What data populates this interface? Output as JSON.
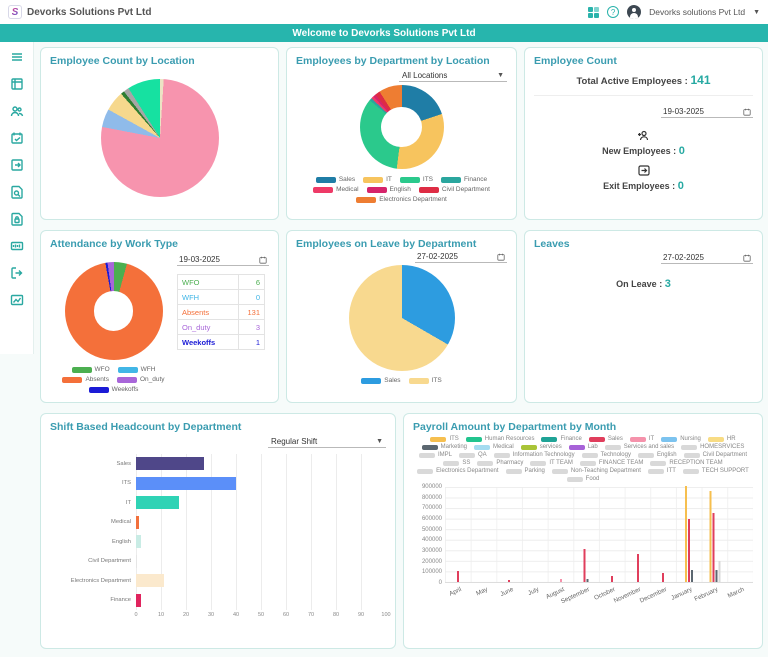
{
  "header": {
    "logo_letter": "S",
    "company_name": "Devorks Solutions Pvt Ltd",
    "account_name": "Devorks solutions Pvt Ltd",
    "banner": "Welcome to Devorks Solutions Pvt Ltd"
  },
  "sidebar": {
    "icons": [
      "menu",
      "payslip",
      "team",
      "calendar-check",
      "checkout",
      "report-search",
      "document-lock",
      "crm",
      "logout",
      "analytics"
    ]
  },
  "cards": {
    "location_count": {
      "title": "Employee Count by Location"
    },
    "dept_by_location": {
      "title": "Employees by Department by Location",
      "filter": "All Locations"
    },
    "employee_count": {
      "title": "Employee Count",
      "total_label": "Total Active Employees :",
      "total_value": "141",
      "date": "19-03-2025",
      "new_label": "New Employees :",
      "new_value": "0",
      "exit_label": "Exit Employees :",
      "exit_value": "0"
    },
    "attendance": {
      "title": "Attendance by Work Type",
      "date": "19-03-2025"
    },
    "leave_dept": {
      "title": "Employees on Leave by Department",
      "date": "27-02-2025"
    },
    "leaves": {
      "title": "Leaves",
      "date": "27-02-2025",
      "label": "On Leave :",
      "value": "3"
    },
    "shift": {
      "title": "Shift Based Headcount by Department",
      "filter": "Regular Shift"
    },
    "payroll": {
      "title": "Payroll Amount by Department by Month"
    }
  },
  "chart_data": [
    {
      "id": "location_pie",
      "type": "pie",
      "title": "Employee Count by Location",
      "segments": [
        {
          "color": "#ece3c4",
          "percent": 1
        },
        {
          "color": "#f794ae",
          "percent": 77
        },
        {
          "color": "#8fbbea",
          "percent": 5
        },
        {
          "color": "#f6d88d",
          "percent": 5.5
        },
        {
          "color": "#2e7d32",
          "percent": 1
        },
        {
          "color": "#a6a6a6",
          "percent": 1.5
        },
        {
          "color": "#16e1a1",
          "percent": 9
        }
      ]
    },
    {
      "id": "dept_donut",
      "type": "pie",
      "donut": true,
      "title": "Employees by Department by Location",
      "slices": [
        {
          "label": "Sales",
          "color": "#1f7da6",
          "percent": 20
        },
        {
          "label": "IT",
          "color": "#f7c45e",
          "percent": 32
        },
        {
          "label": "ITS",
          "color": "#2bc98c",
          "percent": 34
        },
        {
          "label": "Finance",
          "color": "#2aa69e",
          "percent": 1
        },
        {
          "label": "Medical",
          "color": "#ee3a67",
          "percent": 1
        },
        {
          "label": "English",
          "color": "#d6246b",
          "percent": 1
        },
        {
          "label": "Civil Department",
          "color": "#de2c44",
          "percent": 2
        },
        {
          "label": "Electronics Department",
          "color": "#ee7d32",
          "percent": 9
        }
      ]
    },
    {
      "id": "attendance_donut",
      "type": "pie",
      "donut": true,
      "title": "Attendance by Work Type",
      "date": "19-03-2025",
      "rows": [
        {
          "label": "WFO",
          "value": 6,
          "color": "#4caf50"
        },
        {
          "label": "WFH",
          "value": 0,
          "color": "#41b6e6"
        },
        {
          "label": "Absents",
          "value": 131,
          "color": "#f4703a"
        },
        {
          "label": "On_duty",
          "value": 3,
          "color": "#a866d9"
        },
        {
          "label": "Weekoffs",
          "value": 1,
          "color": "#1b1bd6"
        }
      ],
      "draw_order": [
        "WFO",
        "Absents",
        "Weekoffs",
        "On_duty",
        "WFH"
      ]
    },
    {
      "id": "leave_pie",
      "type": "pie",
      "title": "Employees on Leave by Department",
      "date": "27-02-2025",
      "slices": [
        {
          "label": "Sales",
          "color": "#2d9ce0",
          "value": 1
        },
        {
          "label": "ITS",
          "color": "#f8d98f",
          "value": 2
        }
      ]
    },
    {
      "id": "shift_bar",
      "type": "bar",
      "orientation": "horizontal",
      "title": "Shift Based Headcount by Department",
      "filter": "Regular Shift",
      "categories": [
        "Sales",
        "ITS",
        "IT",
        "Medical",
        "English",
        "Civil Department",
        "Electronics Department",
        "Finance"
      ],
      "values": [
        27,
        40,
        17,
        1,
        2,
        0.5,
        11,
        2
      ],
      "bar_colors": [
        "#4f4789",
        "#5b8ff9",
        "#2fd3b5",
        "#f2703c",
        "#c9ece5",
        "#e6e6e6",
        "#fbe9cd",
        "#e0245e"
      ],
      "xlim": [
        0,
        100
      ],
      "x_ticks": [
        0,
        10,
        20,
        30,
        40,
        50,
        60,
        70,
        80,
        90,
        100
      ]
    },
    {
      "id": "payroll_bar",
      "type": "bar",
      "orientation": "vertical",
      "title": "Payroll Amount by Department by Month",
      "ylim": [
        0,
        900000
      ],
      "y_ticks": [
        0,
        100000,
        200000,
        300000,
        400000,
        500000,
        600000,
        700000,
        800000,
        900000
      ],
      "legend": [
        {
          "label": "ITS",
          "color": "#f6bf4f"
        },
        {
          "label": "Human Resources",
          "color": "#22c48e"
        },
        {
          "label": "Finance",
          "color": "#1fa396"
        },
        {
          "label": "Sales",
          "color": "#e03e5c"
        },
        {
          "label": "IT",
          "color": "#f592ab"
        },
        {
          "label": "Nursing",
          "color": "#7cc3ef"
        },
        {
          "label": "HR",
          "color": "#f8dc84"
        },
        {
          "label": "Marketing",
          "color": "#5b6770"
        },
        {
          "label": "Medical",
          "color": "#a5dcf0"
        },
        {
          "label": "services",
          "color": "#a9c437"
        },
        {
          "label": "Lab",
          "color": "#a762d8"
        },
        {
          "label": "Services and sales",
          "color": "#d9d9d9"
        },
        {
          "label": "HOMESRVICES",
          "color": "#d9d9d9"
        },
        {
          "label": "IMPL",
          "color": "#d9d9d9"
        },
        {
          "label": "QA",
          "color": "#d9d9d9"
        },
        {
          "label": "Information Technology",
          "color": "#d9d9d9"
        },
        {
          "label": "Technology",
          "color": "#d9d9d9"
        },
        {
          "label": "English",
          "color": "#d9d9d9"
        },
        {
          "label": "Civil Department",
          "color": "#d9d9d9"
        },
        {
          "label": "SS",
          "color": "#d9d9d9"
        },
        {
          "label": "Pharmacy",
          "color": "#d9d9d9"
        },
        {
          "label": "IT TEAM",
          "color": "#d9d9d9"
        },
        {
          "label": "FINANCE TEAM",
          "color": "#d9d9d9"
        },
        {
          "label": "RECEPTION TEAM",
          "color": "#d9d9d9"
        },
        {
          "label": "Electronics Department",
          "color": "#d9d9d9"
        },
        {
          "label": "Parking",
          "color": "#d9d9d9"
        },
        {
          "label": "Non-Teaching Department",
          "color": "#d9d9d9"
        },
        {
          "label": "ITT",
          "color": "#d9d9d9"
        },
        {
          "label": "TECH SUPPORT",
          "color": "#d9d9d9"
        },
        {
          "label": "Food",
          "color": "#d9d9d9"
        }
      ],
      "months": [
        "April",
        "May",
        "June",
        "July",
        "August",
        "September",
        "October",
        "November",
        "December",
        "January",
        "February",
        "March"
      ],
      "bars": [
        {
          "month": "April",
          "series": [
            {
              "label": "Sales",
              "value": 100000
            }
          ]
        },
        {
          "month": "May",
          "series": []
        },
        {
          "month": "June",
          "series": [
            {
              "label": "Sales",
              "value": 20000
            }
          ]
        },
        {
          "month": "July",
          "series": []
        },
        {
          "month": "August",
          "series": [
            {
              "label": "IT",
              "value": 30000
            }
          ]
        },
        {
          "month": "September",
          "series": [
            {
              "label": "Sales",
              "value": 310000
            },
            {
              "label": "Marketing",
              "value": 30000
            }
          ]
        },
        {
          "month": "October",
          "series": [
            {
              "label": "Sales",
              "value": 60000
            }
          ]
        },
        {
          "month": "November",
          "series": [
            {
              "label": "Sales",
              "value": 260000
            }
          ]
        },
        {
          "month": "December",
          "series": [
            {
              "label": "Sales",
              "value": 80000
            }
          ]
        },
        {
          "month": "January",
          "series": [
            {
              "label": "ITS",
              "value": 900000
            },
            {
              "label": "Sales",
              "value": 590000
            },
            {
              "label": "Marketing",
              "value": 110000
            }
          ]
        },
        {
          "month": "February",
          "series": [
            {
              "label": "ITS",
              "value": 850000
            },
            {
              "label": "Sales",
              "value": 650000
            },
            {
              "label": "Marketing",
              "value": 110000
            },
            {
              "label": "Services and sales",
              "value": 200000
            }
          ]
        },
        {
          "month": "March",
          "series": []
        }
      ]
    }
  ]
}
